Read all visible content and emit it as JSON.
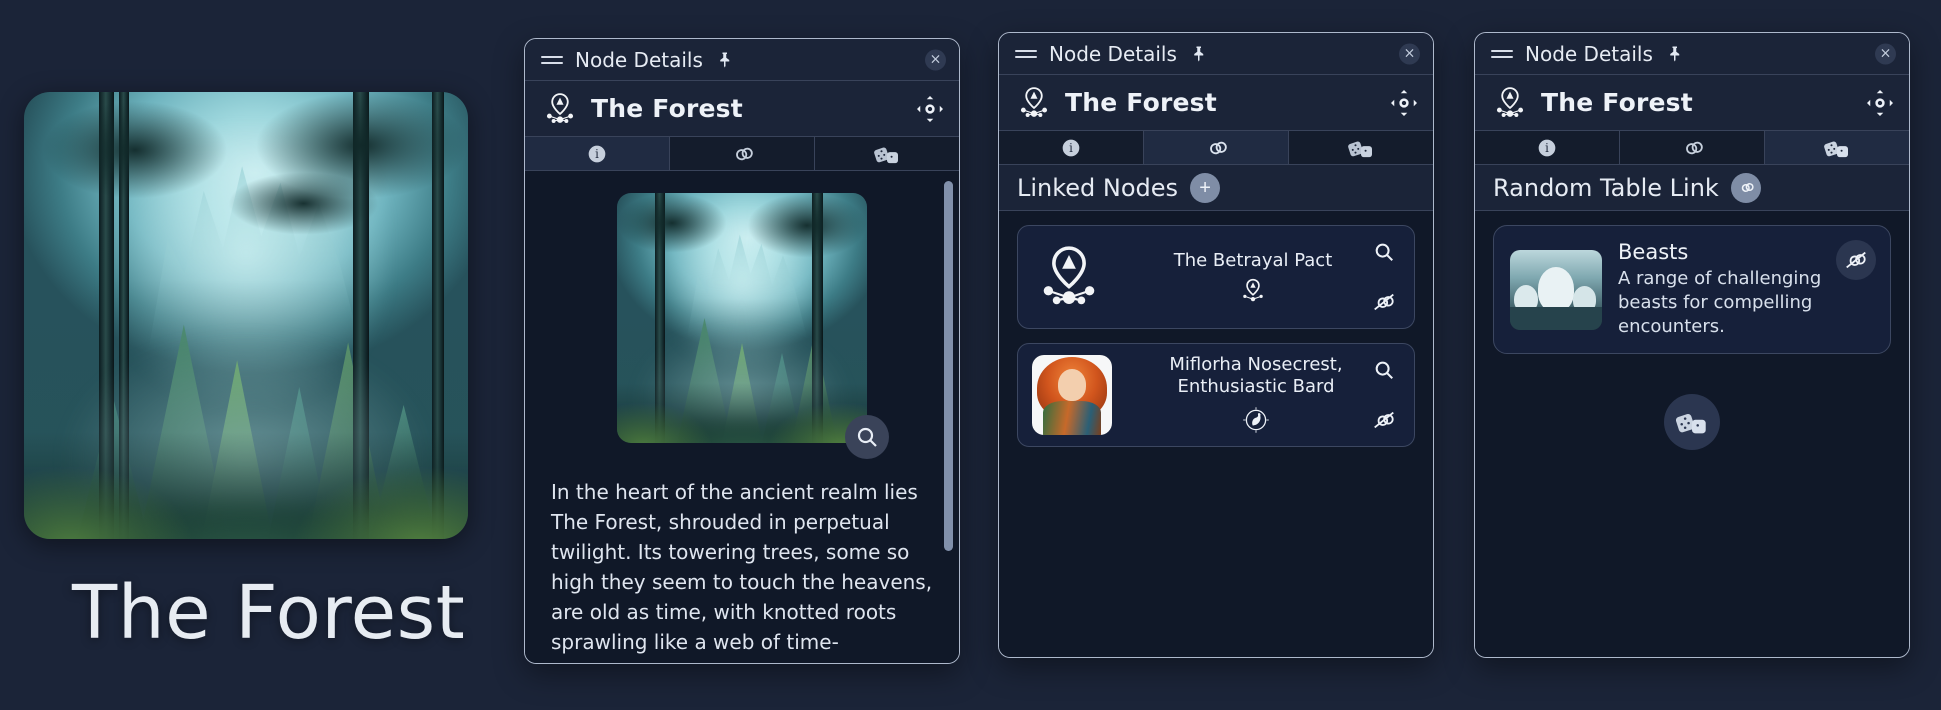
{
  "app": {
    "background_color": "#1b2438",
    "panel_border_color": "#aeb9cc",
    "accent_color": "#7f8da6"
  },
  "hero": {
    "title": "The Forest",
    "image_alt": "forest-artwork"
  },
  "panels": [
    {
      "id": "info",
      "header": {
        "title": "Node Details",
        "drag_handle": "hamburger-icon",
        "pin": "pin-icon",
        "close": "×"
      },
      "node": {
        "name": "The Forest",
        "glyph": "map-node-pin-icon",
        "focus": "focus-target-icon"
      },
      "tabs": [
        {
          "id": "info",
          "icon": "info-circle-icon",
          "active": true
        },
        {
          "id": "links",
          "icon": "link-chain-icon",
          "active": false
        },
        {
          "id": "tables",
          "icon": "dice-icon",
          "active": false
        }
      ],
      "content": {
        "image_alt": "forest-thumbnail",
        "zoom_button": "magnify-icon",
        "description": "In the heart of the ancient realm lies The Forest, shrouded in perpetual twilight. Its towering trees, some so high they seem to touch the heavens, are old as time, with knotted roots sprawling like a web of time-"
      }
    },
    {
      "id": "links",
      "header": {
        "title": "Node Details",
        "drag_handle": "hamburger-icon",
        "pin": "pin-icon",
        "close": "×"
      },
      "node": {
        "name": "The Forest",
        "glyph": "map-node-pin-icon",
        "focus": "focus-target-icon"
      },
      "tabs": [
        {
          "id": "info",
          "icon": "info-circle-icon",
          "active": false
        },
        {
          "id": "links",
          "icon": "link-chain-icon",
          "active": true
        },
        {
          "id": "tables",
          "icon": "dice-icon",
          "active": false
        }
      ],
      "section": {
        "label": "Linked Nodes",
        "add_button": "+"
      },
      "linked_nodes": [
        {
          "title": "The Betrayal Pact",
          "thumb_kind": "map-node-pin-icon",
          "type_glyph": "map-node-pin-icon",
          "actions": {
            "search": "magnify-icon",
            "unlink": "unlink-icon"
          }
        },
        {
          "title": "Miflorha Nosecrest, Enthusiastic Bard",
          "thumb_kind": "portrait",
          "type_glyph": "swan-emblem-icon",
          "actions": {
            "search": "magnify-icon",
            "unlink": "unlink-icon"
          }
        }
      ]
    },
    {
      "id": "tables",
      "header": {
        "title": "Node Details",
        "drag_handle": "hamburger-icon",
        "pin": "pin-icon",
        "close": "×"
      },
      "node": {
        "name": "The Forest",
        "glyph": "map-node-pin-icon",
        "focus": "focus-target-icon"
      },
      "tabs": [
        {
          "id": "info",
          "icon": "info-circle-icon",
          "active": false
        },
        {
          "id": "links",
          "icon": "link-chain-icon",
          "active": false
        },
        {
          "id": "tables",
          "icon": "dice-icon",
          "active": true
        }
      ],
      "section": {
        "label": "Random Table Link",
        "link_button": "link-chain-icon"
      },
      "table_links": [
        {
          "title": "Beasts",
          "description": "A range of challenging beasts for compelling encounters.",
          "thumb_kind": "beasts-artwork",
          "unlink": "unlink-icon"
        }
      ],
      "roll_button": "dice-icon"
    }
  ]
}
